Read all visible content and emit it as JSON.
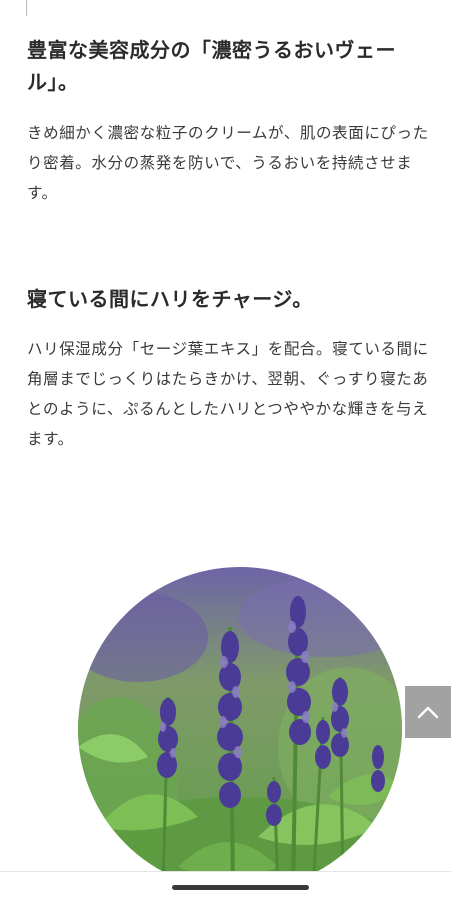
{
  "section_1": {
    "heading": "豊富な美容成分の「濃密うるおいヴェール」。",
    "body": "きめ細かく濃密な粒子のクリームが、肌の表面にぴったり密着。水分の蒸発を防いで、うるおいを持続させます。"
  },
  "section_2": {
    "heading": "寝ている間にハリをチャージ。",
    "body": "ハリ保湿成分「セージ葉エキス」を配合。寝ている間に角層までじっくりはたらきかけ、翌朝、ぐっすり寝たあとのように、ぷるんとしたハリとつややかな輝きを与えます。"
  },
  "image": {
    "subject": "sage flowers",
    "colors": {
      "flower": "#5a4aa0",
      "flower_light": "#8a7cc8",
      "leaf": "#6aa84f",
      "leaf_dark": "#3f7a2e"
    }
  },
  "scroll_top": {
    "icon": "chevron-up-icon",
    "color": "#9b9b9b"
  }
}
